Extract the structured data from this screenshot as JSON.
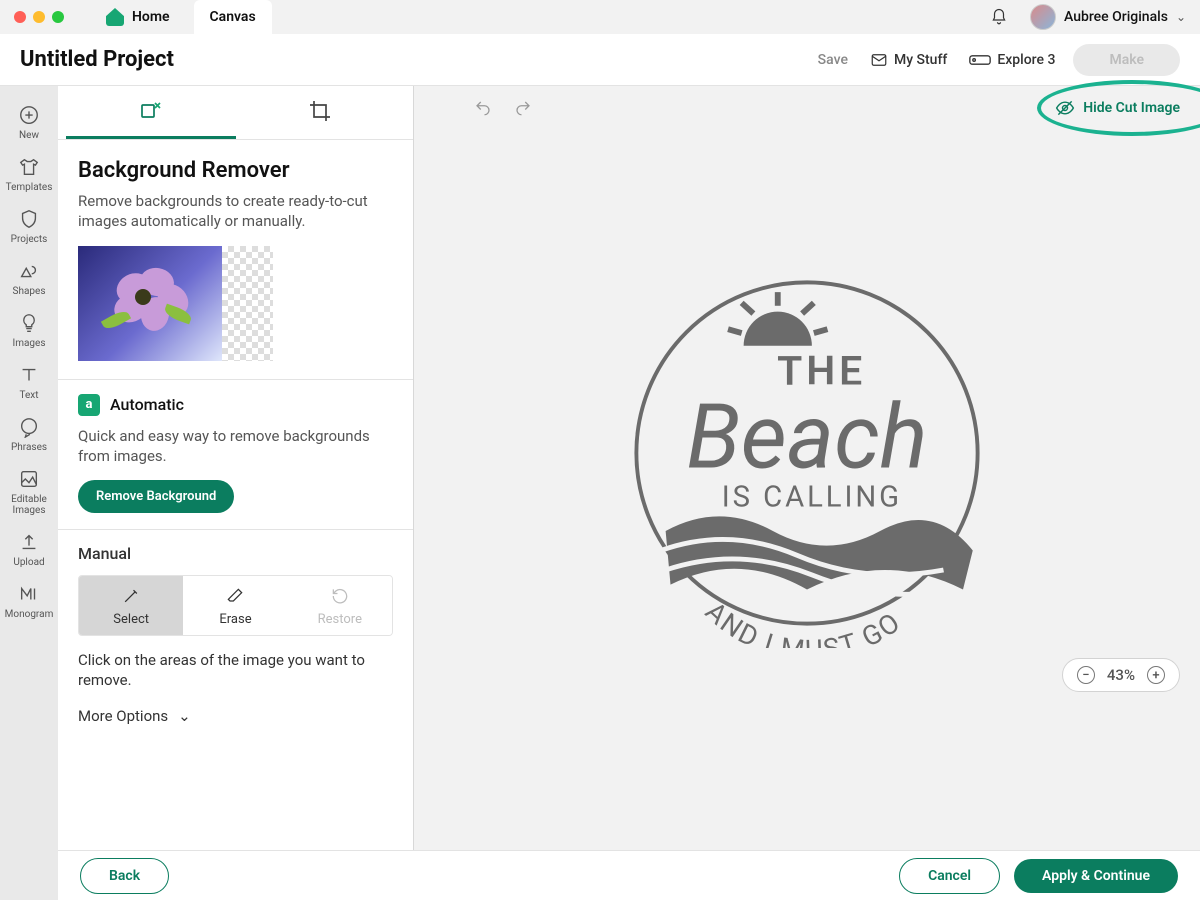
{
  "titlebar": {
    "home_label": "Home",
    "canvas_label": "Canvas",
    "username": "Aubree Originals"
  },
  "header": {
    "project_title": "Untitled Project",
    "save_label": "Save",
    "mystuff_label": "My Stuff",
    "explore_label": "Explore 3",
    "make_label": "Make"
  },
  "rail": [
    {
      "id": "new",
      "label": "New"
    },
    {
      "id": "templates",
      "label": "Templates"
    },
    {
      "id": "projects",
      "label": "Projects"
    },
    {
      "id": "shapes",
      "label": "Shapes"
    },
    {
      "id": "images",
      "label": "Images"
    },
    {
      "id": "text",
      "label": "Text"
    },
    {
      "id": "phrases",
      "label": "Phrases"
    },
    {
      "id": "editable",
      "label": "Editable Images"
    },
    {
      "id": "upload",
      "label": "Upload"
    },
    {
      "id": "monogram",
      "label": "Monogram"
    }
  ],
  "panel": {
    "heading": "Background Remover",
    "subtext": "Remove backgrounds to create ready-to-cut images automatically or manually.",
    "auto_badge": "a",
    "auto_title": "Automatic",
    "auto_desc": "Quick and easy way to remove backgrounds from images.",
    "remove_btn": "Remove Background",
    "manual_title": "Manual",
    "tools": {
      "select": "Select",
      "erase": "Erase",
      "restore": "Restore"
    },
    "manual_note": "Click on the areas of the image you want to remove.",
    "more_options": "More Options"
  },
  "canvas": {
    "hide_cut_label": "Hide Cut Image",
    "artwork_line1": "THE",
    "artwork_brand": "Beach",
    "artwork_line2": "IS CALLING",
    "artwork_line3": "AND I MUST GO",
    "zoom": "43%"
  },
  "footer": {
    "back": "Back",
    "cancel": "Cancel",
    "apply": "Apply & Continue"
  },
  "colors": {
    "accent": "#0b7d5f",
    "highlight": "#1bb290"
  }
}
